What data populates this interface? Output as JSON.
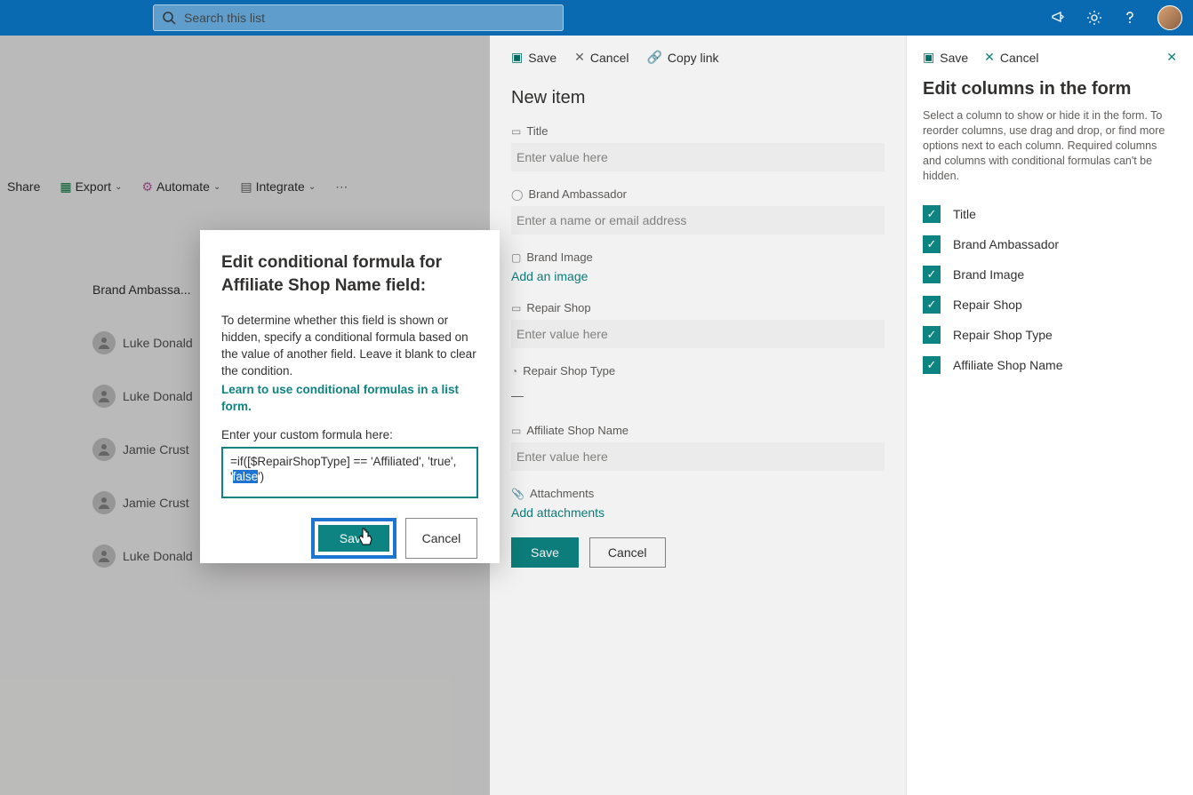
{
  "topbar": {
    "search_placeholder": "Search this list"
  },
  "cmdbar": {
    "share": "Share",
    "export": "Export",
    "automate": "Automate",
    "integrate": "Integrate"
  },
  "list": {
    "column_header": "Brand Ambassa...",
    "rows": [
      {
        "name": "Luke Donald"
      },
      {
        "name": "Luke Donald"
      },
      {
        "name": "Jamie Crust"
      },
      {
        "name": "Jamie Crust"
      },
      {
        "name": "Luke Donald"
      }
    ]
  },
  "form": {
    "toolbar": {
      "save": "Save",
      "cancel": "Cancel",
      "copy": "Copy link"
    },
    "title": "New item",
    "fields": {
      "title_label": "Title",
      "title_placeholder": "Enter value here",
      "ambassador_label": "Brand Ambassador",
      "ambassador_placeholder": "Enter a name or email address",
      "image_label": "Brand Image",
      "image_link": "Add an image",
      "shop_label": "Repair Shop",
      "shop_placeholder": "Enter value here",
      "type_label": "Repair Shop Type",
      "type_value": "—",
      "affiliate_label": "Affiliate Shop Name",
      "affiliate_placeholder": "Enter value here",
      "attach_label": "Attachments",
      "attach_link": "Add attachments"
    },
    "save_btn": "Save",
    "cancel_btn": "Cancel"
  },
  "cols_panel": {
    "save": "Save",
    "cancel": "Cancel",
    "title": "Edit columns in the form",
    "desc": "Select a column to show or hide it in the form. To reorder columns, use drag and drop, or find more options next to each column. Required columns and columns with conditional formulas can't be hidden.",
    "items": [
      "Title",
      "Brand Ambassador",
      "Brand Image",
      "Repair Shop",
      "Repair Shop Type",
      "Affiliate Shop Name"
    ]
  },
  "modal": {
    "title": "Edit conditional formula for Affiliate Shop Name field:",
    "desc": "To determine whether this field is shown or hidden, specify a conditional formula based on the value of another field. Leave it blank to clear the condition.",
    "link": "Learn to use conditional formulas in a list form.",
    "field_label": "Enter your custom formula here:",
    "formula_prefix": "=if([$RepairShopType] == 'Affiliated', 'true', '",
    "formula_sel": "false",
    "formula_suffix": "')",
    "save": "Save",
    "cancel": "Cancel"
  }
}
